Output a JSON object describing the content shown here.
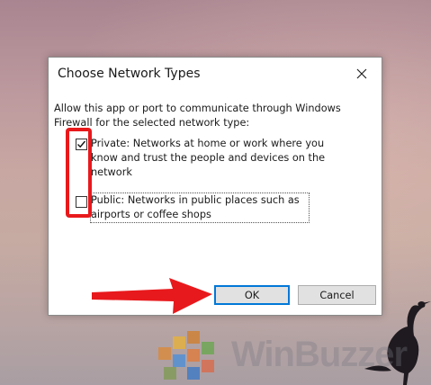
{
  "dialog": {
    "title": "Choose Network Types",
    "description": "Allow this app or port to communicate through Windows Firewall for the selected network type:",
    "private_label": "Private:  Networks at home or work where you know and trust the people and devices on the network",
    "public_label": "Public:  Networks in public places such as airports or coffee shops",
    "private_checked": true,
    "public_checked": false,
    "ok_label": "OK",
    "cancel_label": "Cancel"
  },
  "watermark": {
    "text": "WinBuzzer"
  },
  "colors": {
    "highlight": "#e8191c",
    "accent": "#0078d7"
  }
}
